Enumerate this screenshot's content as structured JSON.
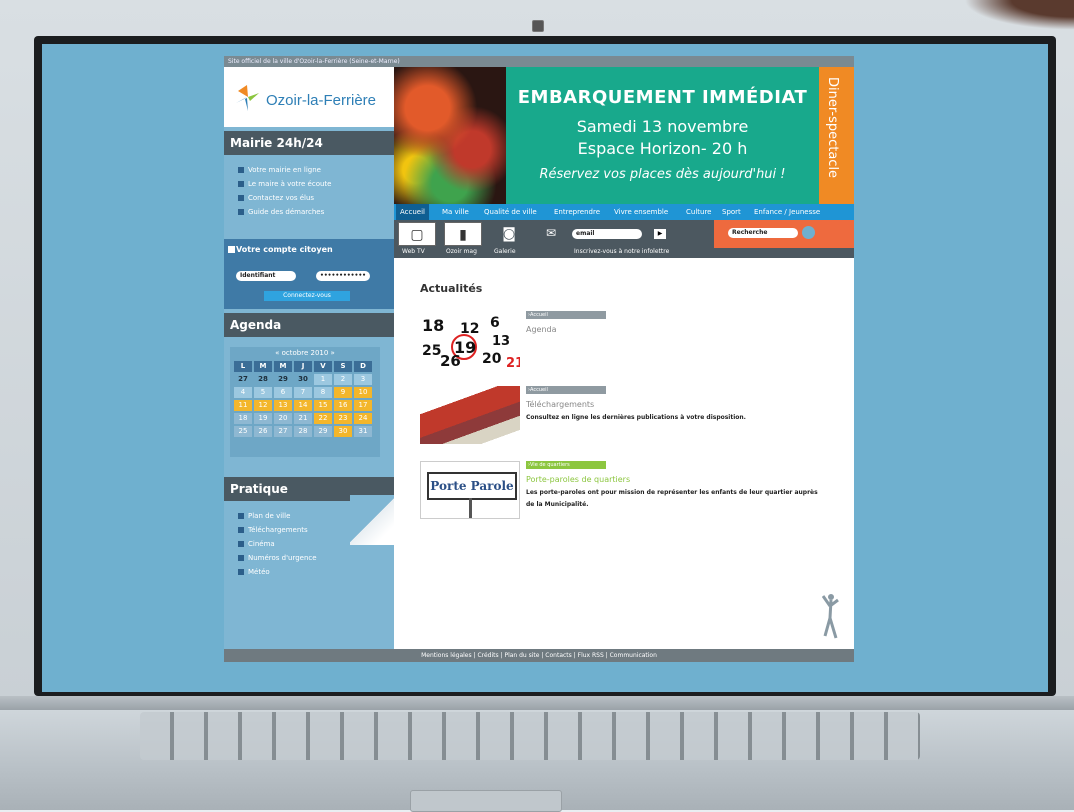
{
  "site": {
    "tagline": "Site officiel de la ville d'Ozoir-la-Ferrière (Seine-et-Marne)",
    "logo_name": "Ozoir-la-Ferrière"
  },
  "sidebar": {
    "mairie_title": "Mairie 24h/24",
    "mairie_links": [
      "Votre mairie en ligne",
      "Le maire à votre écoute",
      "Contactez vos élus",
      "Guide des démarches"
    ],
    "account_title": "Votre compte citoyen",
    "login_placeholder": "Identifiant",
    "password_value": "••••••••••••",
    "connect_label": "Connectez-vous",
    "agenda_title": "Agenda",
    "calendar_month": "« octobre 2010 »",
    "calendar_headers": [
      "L",
      "M",
      "M",
      "J",
      "V",
      "S",
      "D"
    ],
    "calendar_days": [
      "27",
      "28",
      "29",
      "30",
      "1",
      "2",
      "3",
      "4",
      "5",
      "6",
      "7",
      "8",
      "9",
      "10",
      "11",
      "12",
      "13",
      "14",
      "15",
      "16",
      "17",
      "18",
      "19",
      "20",
      "21",
      "22",
      "23",
      "24",
      "25",
      "26",
      "27",
      "28",
      "29",
      "30",
      "31"
    ],
    "pratique_title": "Pratique",
    "pratique_links": [
      "Plan de ville",
      "Téléchargements",
      "Cinéma",
      "Numéros d'urgence",
      "Météo"
    ]
  },
  "banner": {
    "headline": "EMBARQUEMENT IMMÉDIAT",
    "line1": "Samedi 13 novembre",
    "line2": "Espace Horizon- 20 h",
    "line3": "Réservez vos places dès aujourd'hui !",
    "side": "Diner-spectacle"
  },
  "nav": [
    "Accueil",
    "Ma ville",
    "Qualité de ville",
    "Entreprendre",
    "Vivre ensemble",
    "Culture",
    "Sport",
    "Enfance / Jeunesse"
  ],
  "tools": {
    "webtv": "Web TV",
    "mag": "Ozoir mag",
    "gallery": "Galerie",
    "newsletter": "Inscrivez-vous à notre infolettre",
    "email_placeholder": "email",
    "search_placeholder": "Recherche"
  },
  "content": {
    "title": "Actualités",
    "items": [
      {
        "tag": "›Accueil",
        "title": "Agenda",
        "desc": ""
      },
      {
        "tag": "›Accueil",
        "title": "Téléchargements",
        "desc": "Consultez en ligne les dernières publications à votre disposition."
      },
      {
        "tag": "›Vie de quartiers",
        "title": "Porte-paroles de quartiers",
        "desc": "Les porte-paroles ont pour mission de représenter les enfants de leur quartier auprès de la Municipalité."
      }
    ],
    "porte_parole_sign": "Porte Parole",
    "cal_numbers": [
      "18",
      "12",
      "6",
      "13",
      "19",
      "25",
      "26",
      "20",
      "21"
    ]
  },
  "footer": "Mentions légales | Crédits | Plan du site | Contacts | Flux RSS | Communication",
  "colors": {
    "nav": "#1f95d5",
    "banner": "#18a98c",
    "banner_side": "#f08a24",
    "vie_quartiers": "#8cc63f",
    "sidebar": "#7fb6d3"
  }
}
